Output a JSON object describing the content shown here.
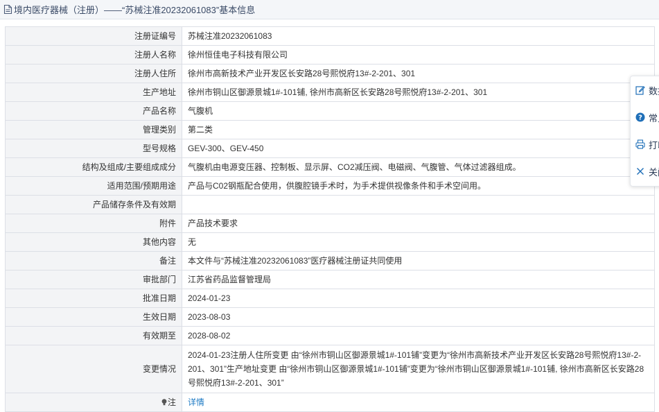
{
  "header": {
    "title": "境内医疗器械（注册）——“苏械注准20232061083”基本信息",
    "icon": "document-icon"
  },
  "rows": [
    {
      "label": "注册证编号",
      "value": "苏械注准20232061083"
    },
    {
      "label": "注册人名称",
      "value": "徐州恒佳电子科技有限公司"
    },
    {
      "label": "注册人住所",
      "value": "徐州市高新技术产业开发区长安路28号熙悦府13#-2-201、301"
    },
    {
      "label": "生产地址",
      "value": "徐州市铜山区御源景城1#-101铺, 徐州市高新区长安路28号熙悦府13#-2-201、301"
    },
    {
      "label": "产品名称",
      "value": "气腹机"
    },
    {
      "label": "管理类别",
      "value": "第二类"
    },
    {
      "label": "型号规格",
      "value": "GEV-300、GEV-450"
    },
    {
      "label": "结构及组成/主要组成成分",
      "value": "气腹机由电源变压器、控制板、显示屏、CO2减压阀、电磁阀、气腹管、气体过滤器组成。"
    },
    {
      "label": "适用范围/预期用途",
      "value": "产品与C02钢瓶配合使用，供腹腔镜手术时，为手术提供视像条件和手术空间用。"
    },
    {
      "label": "产品储存条件及有效期",
      "value": ""
    },
    {
      "label": "附件",
      "value": "产品技术要求"
    },
    {
      "label": "其他内容",
      "value": "无"
    },
    {
      "label": "备注",
      "value": "本文件与“苏械注准20232061083”医疗器械注册证共同使用"
    },
    {
      "label": "审批部门",
      "value": "江苏省药品监督管理局"
    },
    {
      "label": "批准日期",
      "value": "2024-01-23"
    },
    {
      "label": "生效日期",
      "value": "2023-08-03"
    },
    {
      "label": "有效期至",
      "value": "2028-08-02"
    }
  ],
  "change_row": {
    "label": "变更情况",
    "value": "2024-01-23注册人住所变更 由“徐州市铜山区御源景城1#-101铺”变更为“徐州市高新技术产业开发区长安路28号熙悦府13#-2-201、301”生产地址变更 由“徐州市铜山区御源景城1#-101铺”变更为“徐州市铜山区御源景城1#-101铺, 徐州市高新区长安路28号熙悦府13#-2-201、301”"
  },
  "note_row": {
    "label": "注",
    "icon": "lightbulb-icon",
    "link_text": "详情"
  },
  "float_panel": {
    "items": [
      {
        "label": "数据",
        "icon": "edit-icon"
      },
      {
        "label": "常见",
        "icon": "question-icon"
      },
      {
        "label": "打印",
        "icon": "print-icon"
      },
      {
        "label": "关闭",
        "icon": "close-icon"
      }
    ]
  },
  "colors": {
    "label_bg": "#f3f4f6",
    "border": "#dcdfe6",
    "link": "#1f7bc4",
    "title_text": "#3a4a66",
    "icon_blue": "#1f6fb8"
  }
}
